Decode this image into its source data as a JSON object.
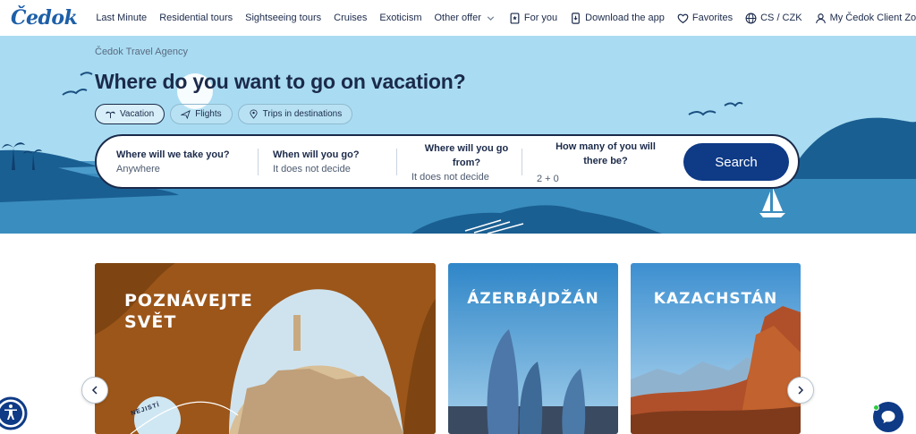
{
  "brand": {
    "logo": "Čedok"
  },
  "nav": {
    "items": [
      {
        "label": "Last Minute"
      },
      {
        "label": "Residential tours"
      },
      {
        "label": "Sightseeing tours"
      },
      {
        "label": "Cruises"
      },
      {
        "label": "Exoticism"
      },
      {
        "label": "Other offer",
        "icon": "chevron-down-icon"
      },
      {
        "label": "For you",
        "icon": "bookmark-icon"
      },
      {
        "label": "Download the app",
        "icon": "phone-icon"
      },
      {
        "label": "Favorites",
        "icon": "heart-icon"
      },
      {
        "label": "CS / CZK",
        "icon": "globe-icon"
      },
      {
        "label": "My Čedok Client Zone",
        "icon": "user-icon"
      }
    ]
  },
  "hero": {
    "breadcrumb": "Čedok Travel Agency",
    "headline": "Where do you want to go on vacation?",
    "tabs": [
      {
        "label": "Vacation",
        "icon": "palm-icon",
        "active": true
      },
      {
        "label": "Flights",
        "icon": "plane-icon",
        "active": false
      },
      {
        "label": "Trips in destinations",
        "icon": "pin-icon",
        "active": false
      }
    ],
    "search": {
      "fields": [
        {
          "label": "Where will we take you?",
          "value": "Anywhere"
        },
        {
          "label": "When will you go?",
          "value": "It does not decide"
        },
        {
          "label": "Where will you go from?",
          "value": "It does not decide"
        },
        {
          "label": "How many of you will there be?",
          "value": "2 + 0"
        }
      ],
      "button": "Search"
    }
  },
  "carousel": {
    "cards": [
      {
        "title": "POZNÁVEJTE SVĚT",
        "badge": "NEJISTÍ"
      },
      {
        "title": "ÁZERBÁJDŽÁN"
      },
      {
        "title": "KAZACHSTÁN"
      }
    ]
  },
  "colors": {
    "brand": "#1d5fa8",
    "navy": "#0e3a86",
    "sky": "#a9dcf2",
    "sea": "#3a8dbf"
  }
}
